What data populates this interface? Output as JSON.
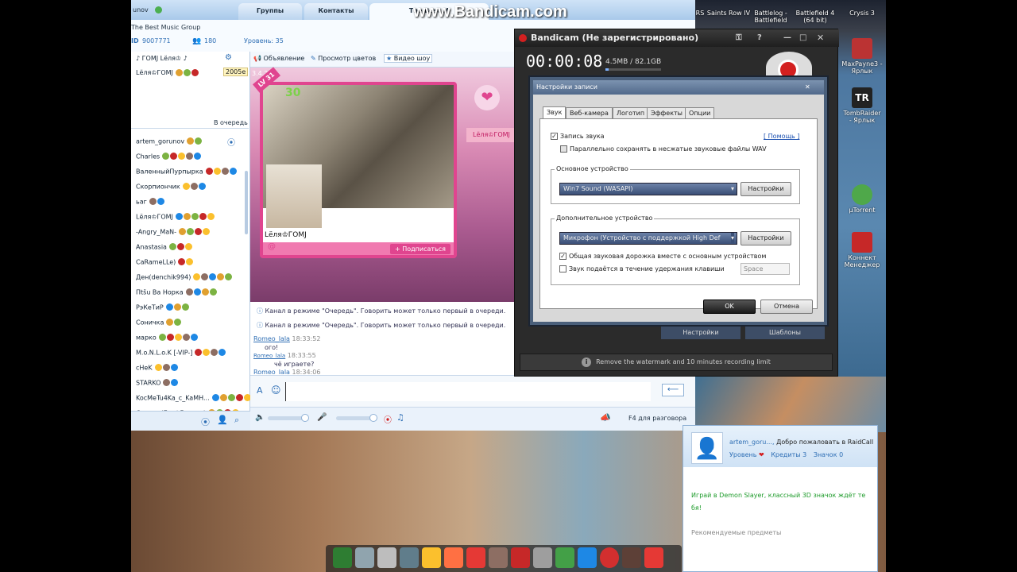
{
  "watermark": "www.Bandicam.com",
  "desktop": {
    "top_icons": [
      {
        "label": "RS",
        "color": "#8a1c1c"
      },
      {
        "label": "Saints Row IV",
        "color": "#3a3a3a"
      },
      {
        "label": "Battlelog - Battlefield ...",
        "color": "#2a3c5c"
      },
      {
        "label": "Battlefield 4 (64 bit)",
        "color": "#1e2f46"
      },
      {
        "label": "Crysis 3",
        "color": "#3c4a3a"
      }
    ],
    "side_icons": [
      {
        "label": "MaxPayne3 - Ярлык",
        "icon": "maxpayne-icon",
        "color": "#b33"
      },
      {
        "label": "TombRaider - Ярлык",
        "icon": "tombraider-icon",
        "color": "#222"
      },
      {
        "label": "µTorrent",
        "icon": "utorrent-icon",
        "color": "#4fa84a"
      },
      {
        "label": "Коннект Менеджер",
        "icon": "connect-manager-icon",
        "color": "#c62828"
      }
    ]
  },
  "raidcall": {
    "user_short": "unov",
    "tabs": [
      "Группы",
      "Контакты",
      "The Best M"
    ],
    "group_name": "The Best Music Group",
    "id_label": "ID",
    "id_value": "9007771",
    "members": "180",
    "level": "Уровень: 35",
    "channel": "♪ ГОМЈ Lёля♔ ♪",
    "channel_user": "Lёля♔ГОМЈ",
    "channel_counter": "2005е",
    "queue_label": "В очередь",
    "version": "3.4.2",
    "toolbar": {
      "announcement": "Объявление",
      "colors": "Просмотр цветов",
      "video": "Видео шоу"
    },
    "users": [
      "artem_gorunov",
      "Charles",
      "ВаленныйПурпырка",
      "Скорпиончик",
      "ьаг",
      "Lёля♔ГОМЈ",
      "-Angry_MaN-",
      "Anastasia",
      "CaRameLLe)",
      "Ден(denchik994)",
      "Пtšu Ba Норка",
      "РэКеТиР",
      "Соничка",
      "марко",
      "M.o.N.L.o.K [-VIP-]",
      "cHeK",
      "STARKO",
      "KocMeTu4Ka_c_KaMH...",
      "Сердца(Ezo^Femme)"
    ],
    "video": {
      "level_badge": "LV 31",
      "score": "30",
      "user": "Lёля♔ГОМЈ",
      "subscribe": "+ Подписаться",
      "side_user": "Lёля♔ГОМЈ"
    },
    "chat": {
      "system_msg": "Канал в режиме \"Очередь\". Говорить может только первый в очереди.",
      "msg1_user": "Romeo_lala",
      "msg1_time": "18:33:52",
      "msg1_text": "ого!",
      "msg2_user": "Romeo_lala",
      "msg2_time": "18:33:55",
      "msg2_text": "чё играете?",
      "msg3_user": "Romeo_lala",
      "msg3_time": "18:34:06"
    },
    "talk_hint": "F4 для разговора"
  },
  "bandicam": {
    "title": "Bandicam (Не зарегистрировано)",
    "timer": "00:00:08",
    "size": "4.5MB / 82.1GB",
    "dialog_title": "Настройки записи",
    "tabs": [
      "Звук",
      "Веб-камера",
      "Логотип",
      "Эффекты",
      "Опции"
    ],
    "record_sound": "Запись звука",
    "help": "[ Помощь ]",
    "save_wav": "Параллельно сохранять в несжатые звуковые файлы WAV",
    "primary_group": "Основное устройство",
    "primary_device": "Win7 Sound (WASAPI)",
    "secondary_group": "Дополнительное устройство",
    "secondary_device": "Микрофон (Устройство с поддержкой High Def",
    "settings_btn": "Настройки",
    "mix_track": "Общая звуковая дорожка вместе с основным устройством",
    "hold_key": "Звук подаётся в течение удержания клавиши",
    "hotkey": "Space",
    "ok": "OK",
    "cancel": "Отмена",
    "bottom_settings": "Настройки",
    "bottom_templates": "Шаблоны",
    "watermark_notice": "Remove the watermark and 10 minutes recording limit"
  },
  "notification": {
    "user": "artem_goru...,",
    "welcome": "Добро пожаловать в RaidCall",
    "level_label": "Уровень",
    "credits_label": "Кредиты",
    "credits_value": "3",
    "points_label": "Значок",
    "points_value": "0",
    "promo": "Играй в Demon Slayer, классный 3D значок ждёт те бя!",
    "recommended": "Рекомендуемые предметы"
  },
  "colors": {
    "rc_accent": "#2f6fb5",
    "promo_green": "#1d9b2a",
    "bandicam_red": "#d32020"
  }
}
